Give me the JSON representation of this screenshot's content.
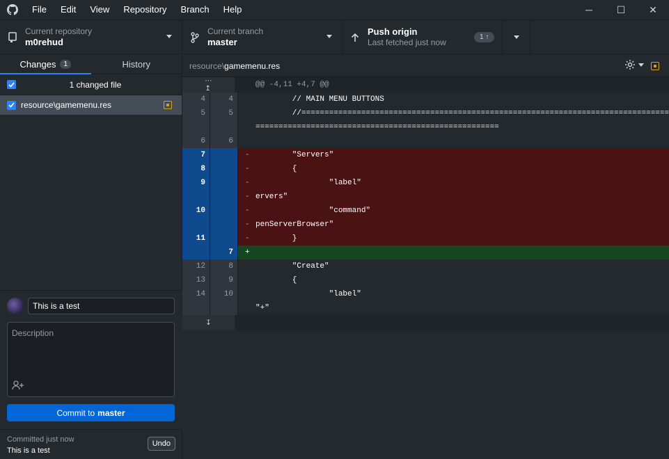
{
  "menu": [
    "File",
    "Edit",
    "View",
    "Repository",
    "Branch",
    "Help"
  ],
  "window_controls": {
    "minimize": "─",
    "maximize": "☐",
    "close": "✕"
  },
  "toolbar": {
    "repo_label": "Current repository",
    "repo_value": "m0rehud",
    "branch_label": "Current branch",
    "branch_value": "master",
    "push_label": "Push origin",
    "push_sub": "Last fetched just now",
    "push_badge": "1 ↑"
  },
  "tabs": {
    "changes": "Changes",
    "changes_count": "1",
    "history": "History"
  },
  "changes": {
    "header": "1 changed file",
    "files": [
      {
        "name": "resource\\gamemenu.res",
        "status": "modified"
      }
    ]
  },
  "commit": {
    "summary_value": "This is a test",
    "description_placeholder": "Description",
    "button_prefix": "Commit to",
    "button_branch": "master"
  },
  "last_commit": {
    "when": "Committed just now",
    "summary": "This is a test",
    "undo": "Undo"
  },
  "diff": {
    "path_dir": "resource\\",
    "path_file": "gamemenu.res",
    "hunk_header": "@@ -4,11 +4,7 @@",
    "lines": [
      {
        "type": "ctx",
        "o": "4",
        "n": "4",
        "text": "        // MAIN MENU BUTTONS"
      },
      {
        "type": "ctx",
        "o": "5",
        "n": "5",
        "text": "        //======================================================================================"
      },
      {
        "type": "ctx",
        "o": "",
        "n": "",
        "text": "====================================================="
      },
      {
        "type": "ctx",
        "o": "6",
        "n": "6",
        "text": ""
      },
      {
        "type": "del",
        "o": "7",
        "n": "",
        "text": "        \"Servers\""
      },
      {
        "type": "del",
        "o": "8",
        "n": "",
        "text": "        {"
      },
      {
        "type": "del",
        "o": "9",
        "n": "",
        "text": "                \"label\"                                                                     \"S"
      },
      {
        "type": "del",
        "o": "",
        "n": "",
        "text": "ervers\""
      },
      {
        "type": "del",
        "o": "10",
        "n": "",
        "text": "                \"command\"                                                                   \"O"
      },
      {
        "type": "del",
        "o": "",
        "n": "",
        "text": "penServerBrowser\""
      },
      {
        "type": "del",
        "o": "11",
        "n": "",
        "text": "        }"
      },
      {
        "type": "add",
        "o": "",
        "n": "7",
        "text": ""
      },
      {
        "type": "ctx",
        "o": "12",
        "n": "8",
        "text": "        \"Create\""
      },
      {
        "type": "ctx",
        "o": "13",
        "n": "9",
        "text": "        {"
      },
      {
        "type": "ctx",
        "o": "14",
        "n": "10",
        "text": "                \"label\""
      },
      {
        "type": "ctx",
        "o": "",
        "n": "",
        "text": "\"+\""
      }
    ]
  }
}
